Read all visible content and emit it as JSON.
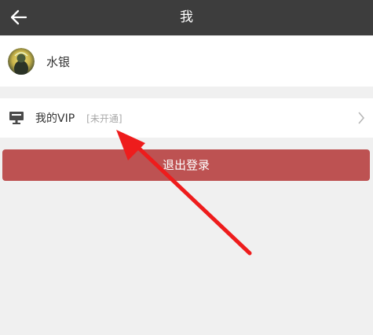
{
  "header": {
    "title": "我"
  },
  "profile": {
    "username": "水银"
  },
  "vip": {
    "label": "我的VIP",
    "status": "[未开通]"
  },
  "logout": {
    "label": "退出登录"
  },
  "colors": {
    "header_bg": "#3d3d3d",
    "page_bg": "#f0f0f0",
    "logout_bg": "#bd5252",
    "annotation_arrow": "#ee1c1c"
  },
  "icons": {
    "back": "arrow-left-icon",
    "vip": "monitor-icon",
    "row_chevron": "chevron-right-icon"
  }
}
